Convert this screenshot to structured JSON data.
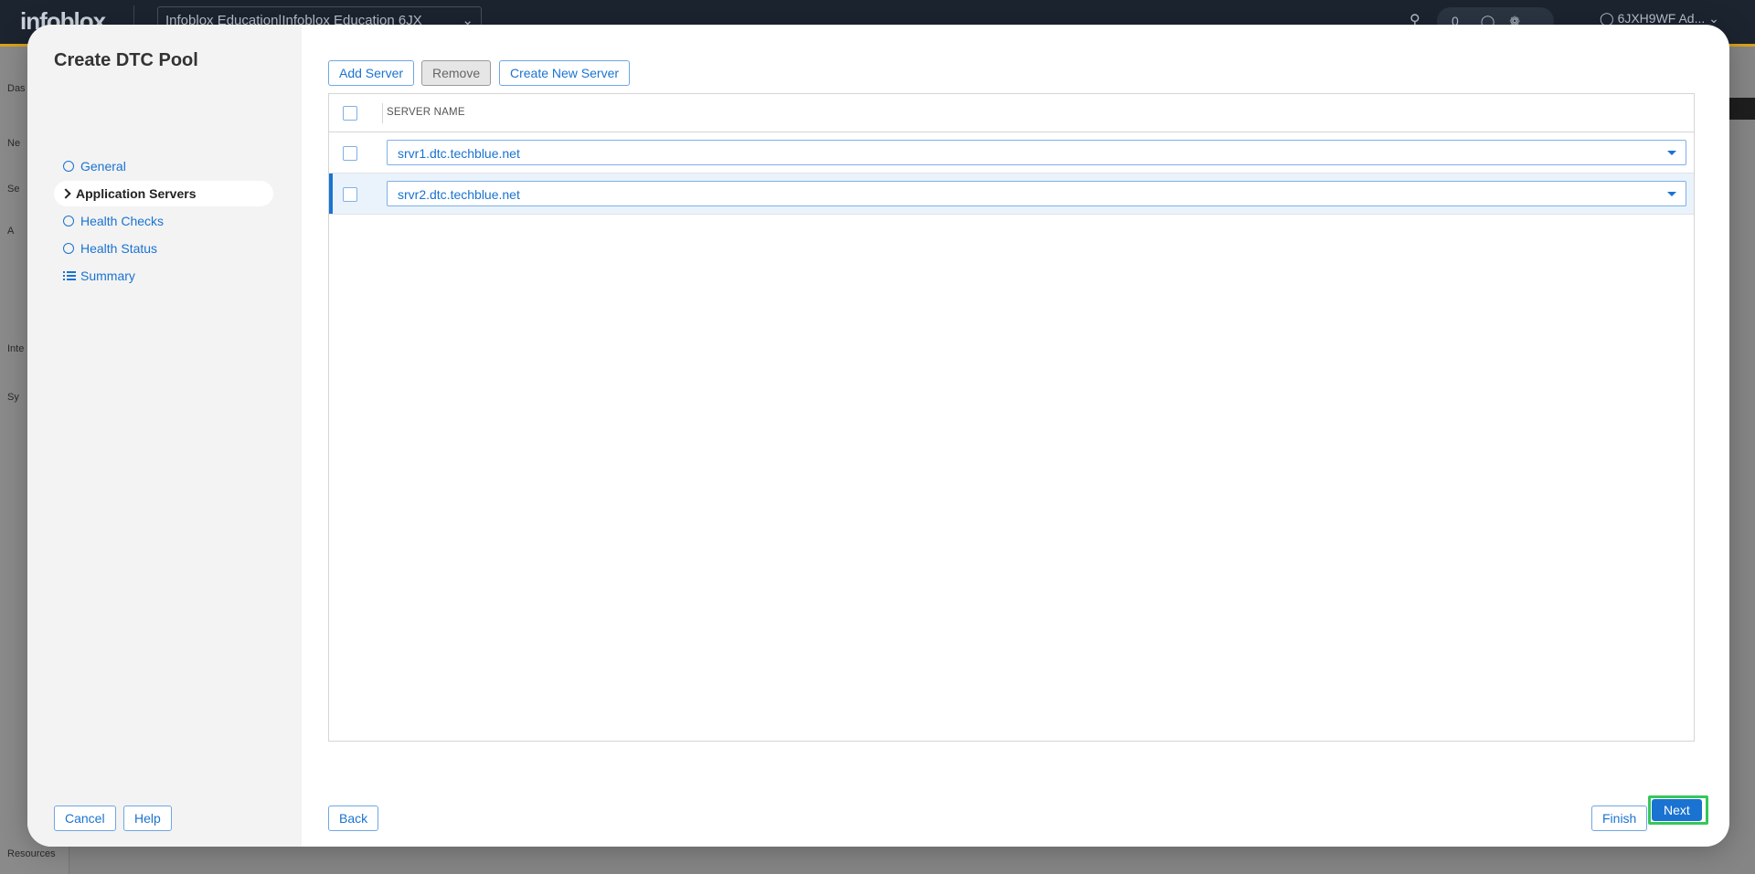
{
  "background": {
    "logo": "infoblox",
    "org_selector": "Infoblox Education|Infoblox Education 6JX",
    "notifications_count": "0",
    "user": "6JXH9WF Ad...",
    "nav_items": [
      "Das",
      "Ne",
      "Se",
      "A",
      "Inte",
      "Sy",
      "Resources"
    ]
  },
  "modal": {
    "title": "Create DTC Pool",
    "steps": [
      {
        "label": "General",
        "icon": "circle-icon",
        "active": false
      },
      {
        "label": "Application Servers",
        "icon": "chevron-right-icon",
        "active": true
      },
      {
        "label": "Health Checks",
        "icon": "circle-icon",
        "active": false
      },
      {
        "label": "Health Status",
        "icon": "circle-icon",
        "active": false
      },
      {
        "label": "Summary",
        "icon": "list-icon",
        "active": false
      }
    ],
    "toolbar": {
      "add_server": "Add Server",
      "remove": "Remove",
      "create_new_server": "Create New Server"
    },
    "grid": {
      "columns": [
        "SERVER NAME"
      ],
      "rows": [
        {
          "server_name": "srvr1.dtc.techblue.net",
          "selected": false
        },
        {
          "server_name": "srvr2.dtc.techblue.net",
          "selected": true
        }
      ]
    },
    "footer": {
      "cancel": "Cancel",
      "help": "Help",
      "back": "Back",
      "finish": "Finish",
      "next": "Next"
    }
  },
  "colors": {
    "accent_blue": "#1a73d1",
    "highlight_green": "#35c75a",
    "topbar": "#1c2430",
    "topbar_accent": "#d9a21b"
  }
}
